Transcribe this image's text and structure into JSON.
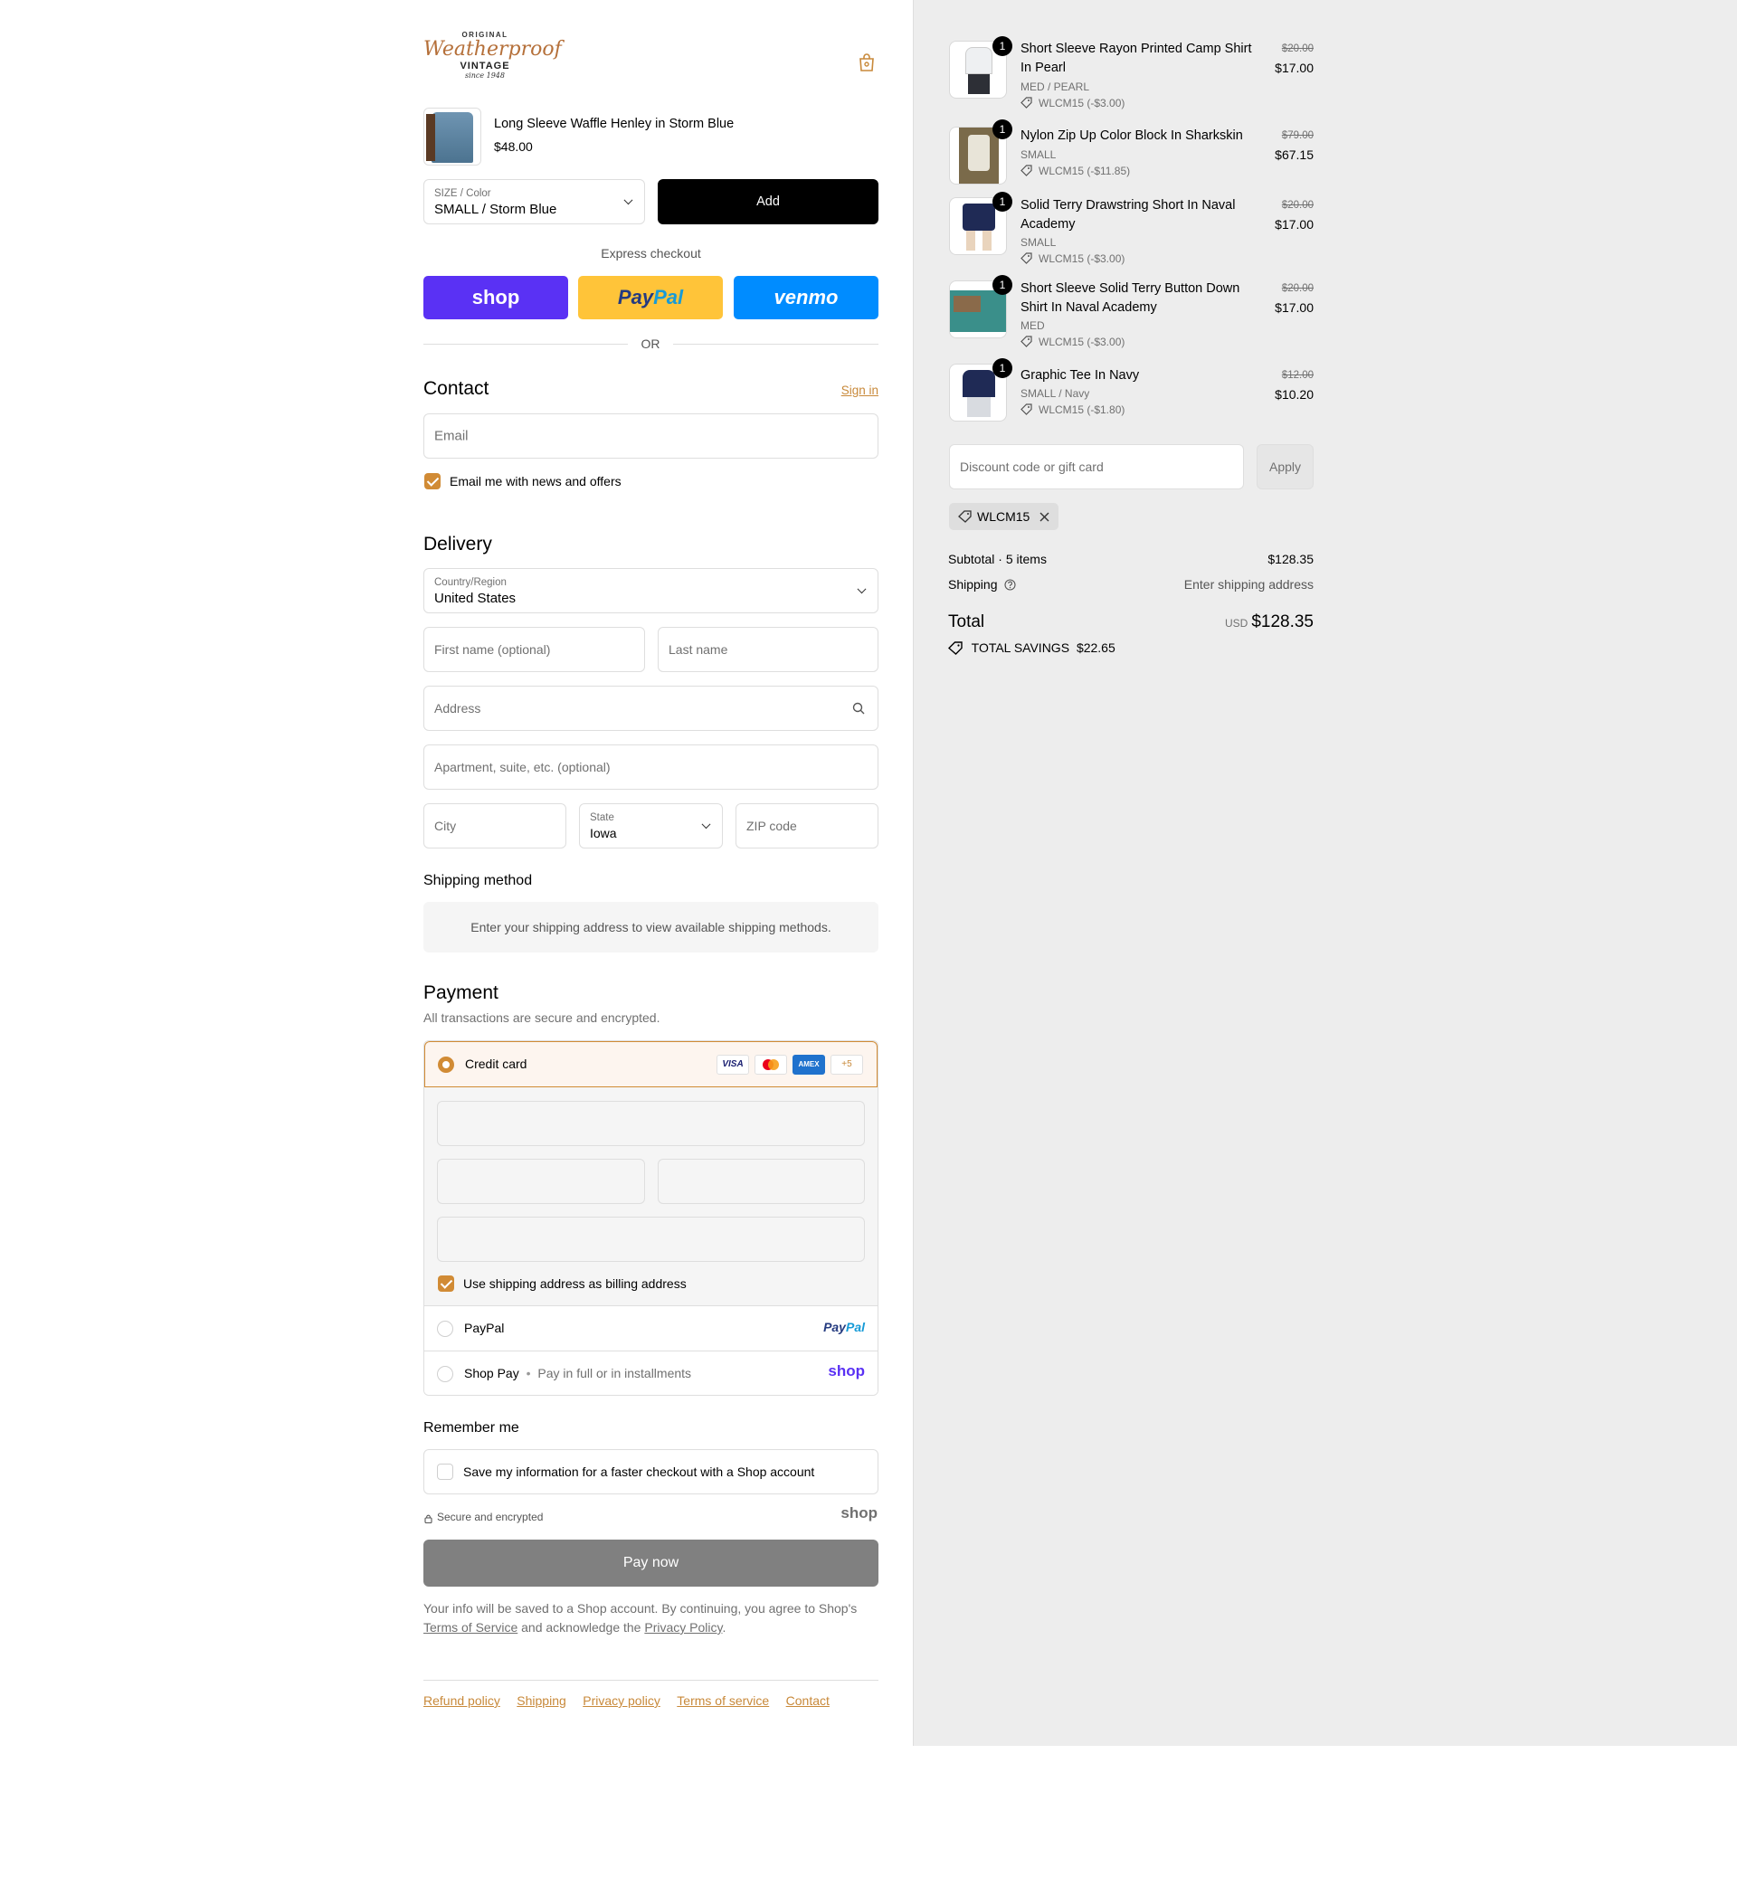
{
  "header": {
    "logo": {
      "top": "ORIGINAL",
      "script": "Weatherproof",
      "vintage": "VINTAGE",
      "since": "since 1948"
    },
    "cart_icon": "shopping-bag-icon"
  },
  "upsell": {
    "name": "Long Sleeve Waffle Henley in Storm Blue",
    "price": "$48.00",
    "size_label_a": "SIZE",
    "size_label_b": " / Color",
    "size_value": "SMALL / Storm Blue",
    "add_label": "Add"
  },
  "express": {
    "title": "Express checkout",
    "shop": "shop",
    "paypal_a": "Pay",
    "paypal_b": "Pal",
    "venmo": "venmo",
    "or": "OR"
  },
  "contact": {
    "title": "Contact",
    "sign_in": "Sign in",
    "email_placeholder": "Email",
    "news_label": "Email me with news and offers"
  },
  "delivery": {
    "title": "Delivery",
    "country_label": "Country/Region",
    "country_value": "United States",
    "first_name": "First name (optional)",
    "last_name": "Last name",
    "address": "Address",
    "apartment": "Apartment, suite, etc. (optional)",
    "city": "City",
    "state_label": "State",
    "state_value": "Iowa",
    "zip": "ZIP code"
  },
  "shipping_method": {
    "title": "Shipping method",
    "message": "Enter your shipping address to view available shipping methods."
  },
  "payment": {
    "title": "Payment",
    "subtitle": "All transactions are secure and encrypted.",
    "credit_card": "Credit card",
    "cards": [
      "VISA",
      "mastercard",
      "AMEX",
      "+5"
    ],
    "billing_same": "Use shipping address as billing address",
    "paypal": "PayPal",
    "paypal_logo_a": "Pay",
    "paypal_logo_b": "Pal",
    "shop_pay": "Shop Pay",
    "shop_pay_note": "Pay in full or in installments",
    "shop_logo": "shop"
  },
  "remember": {
    "title": "Remember me",
    "save_label": "Save my information for a faster checkout with a Shop account",
    "secure": "Secure and encrypted",
    "shop_logo": "shop"
  },
  "pay_now": "Pay now",
  "legal": {
    "line1": "Your info will be saved to a Shop account. By continuing, you agree to Shop's",
    "terms": "Terms of Service",
    "mid": " and acknowledge the ",
    "privacy": "Privacy Policy",
    "end": "."
  },
  "footer": [
    "Refund policy",
    "Shipping",
    "Privacy policy",
    "Terms of service",
    "Contact"
  ],
  "cart": {
    "items": [
      {
        "qty": "1",
        "name": "Short Sleeve Rayon Printed Camp Shirt In Pearl",
        "variant": "MED / PEARL",
        "discount": "WLCM15 (-$3.00)",
        "old": "$20.00",
        "new": "$17.00"
      },
      {
        "qty": "1",
        "name": "Nylon Zip Up Color Block In Sharkskin",
        "variant": "SMALL",
        "discount": "WLCM15 (-$11.85)",
        "old": "$79.00",
        "new": "$67.15"
      },
      {
        "qty": "1",
        "name": "Solid Terry Drawstring Short In Naval Academy",
        "variant": "SMALL",
        "discount": "WLCM15 (-$3.00)",
        "old": "$20.00",
        "new": "$17.00"
      },
      {
        "qty": "1",
        "name": "Short Sleeve Solid Terry Button Down Shirt In Naval Academy",
        "variant": "MED",
        "discount": "WLCM15 (-$3.00)",
        "old": "$20.00",
        "new": "$17.00"
      },
      {
        "qty": "1",
        "name": "Graphic Tee In Navy",
        "variant": "SMALL / Navy",
        "discount": "WLCM15 (-$1.80)",
        "old": "$12.00",
        "new": "$10.20"
      }
    ],
    "discount_placeholder": "Discount code or gift card",
    "apply": "Apply",
    "applied_code": "WLCM15",
    "subtotal_label": "Subtotal · 5 items",
    "subtotal_value": "$128.35",
    "shipping_label": "Shipping",
    "shipping_value": "Enter shipping address",
    "total_label": "Total",
    "currency": "USD",
    "total_value": "$128.35",
    "savings_label": "TOTAL SAVINGS",
    "savings_value": "$22.65"
  },
  "colors": {
    "accent": "#d18b35",
    "shop": "#5a31f4",
    "paypal": "#ffc439",
    "venmo": "#008cff"
  }
}
